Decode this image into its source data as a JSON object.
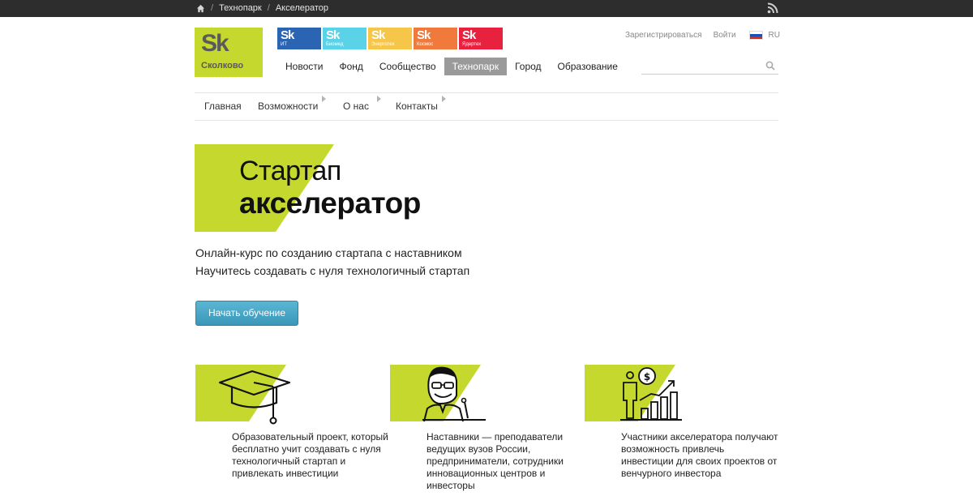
{
  "breadcrumb": {
    "home_icon": "home-icon",
    "items": [
      "Технопарк",
      "Акселератор"
    ],
    "separator": "/"
  },
  "rss_icon": "rss-icon",
  "logo": {
    "mark": "Sk",
    "name": "Сколково"
  },
  "clusters": [
    {
      "mark": "Sk",
      "label": "ИТ",
      "color": "#2c64b4"
    },
    {
      "mark": "Sk",
      "label": "Биомед",
      "color": "#5ad2e8"
    },
    {
      "mark": "Sk",
      "label": "Энерготех",
      "color": "#f5c64a"
    },
    {
      "mark": "Sk",
      "label": "Космос",
      "color": "#f07a3c"
    },
    {
      "mark": "Sk",
      "label": "Ядертех",
      "color": "#e8213e"
    }
  ],
  "main_nav": [
    "Новости",
    "Фонд",
    "Сообщество",
    "Технопарк",
    "Город",
    "Образование"
  ],
  "main_nav_active": "Технопарк",
  "auth": {
    "register": "Зарегистрироваться",
    "login": "Войти",
    "lang": "RU"
  },
  "search": {
    "placeholder": "",
    "icon": "search-icon"
  },
  "sub_nav": [
    "Главная",
    "Возможности",
    "О нас",
    "Контакты"
  ],
  "hero": {
    "title_line1": "Стартап",
    "title_line2": "акселератор",
    "subtitle1": "Онлайн-курс по созданию стартапа с наставником",
    "subtitle2": "Научитесь создавать с нуля технологичный стартап",
    "cta": "Начать обучение"
  },
  "features": [
    {
      "icon": "graduation-cap-icon",
      "text": "Образовательный проект, который бесплатно учит создавать с нуля технологичный стартап и привлекать инвестиции"
    },
    {
      "icon": "mentor-icon",
      "text": "Наставники — преподаватели ведущих вузов России, предприниматели, сотрудники инновационных центров и инвесторы"
    },
    {
      "icon": "investment-growth-icon",
      "text": "Участники акселератора получают возможность привлечь инвестиции для своих проектов от венчурного инвестора"
    }
  ],
  "colors": {
    "brand_green": "#c4d82e",
    "cta_blue": "#3a97b8",
    "topbar": "#2d2d2d",
    "active_nav": "#9a9a9a"
  }
}
